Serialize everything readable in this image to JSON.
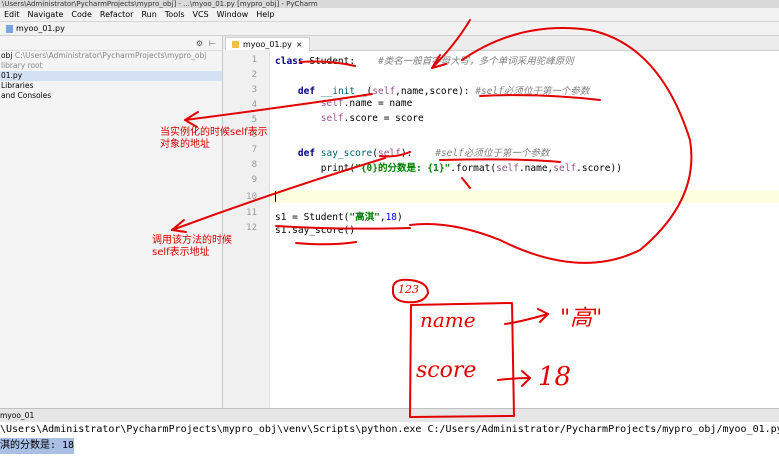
{
  "window": {
    "title": "\\Users\\Administrator\\PycharmProjects\\mypro_obj] - ...\\myoo_01.py [mypro_obj] - PyCharm"
  },
  "menu": [
    "Edit",
    "Navigate",
    "Code",
    "Refactor",
    "Run",
    "Tools",
    "VCS",
    "Window",
    "Help"
  ],
  "navbar": {
    "file": "myoo_01.py"
  },
  "project": {
    "rows": [
      {
        "text": "obj",
        "muted": "C:\\Users\\Administrator\\PycharmProjects\\mypro_obj"
      },
      {
        "text": "",
        "muted": "library root"
      },
      {
        "text": "01.py",
        "muted": ""
      },
      {
        "text": "Libraries",
        "muted": ""
      },
      {
        "text": "and Consoles",
        "muted": ""
      }
    ]
  },
  "editor": {
    "tab": "myoo_01.py",
    "line_numbers": [
      "1",
      "2",
      "3",
      "4",
      "5",
      "6",
      "7",
      "8",
      "9",
      "10",
      "11",
      "12"
    ],
    "lines": {
      "l1_kw": "class ",
      "l1_name": "Student:",
      "l1_cm": "#类名一般首字母大写，多个单词采用驼峰原则",
      "l3_kw": "def ",
      "l3_fn": "__init__",
      "l3_open": "(",
      "l3_self": "self",
      "l3_args": ",name,score):",
      "l3_cm": "#self必须位于第一个参数",
      "l4_self": "self",
      "l4_rest": ".name = name",
      "l5_self": "self",
      "l5_rest": ".score = score",
      "l7_kw": "def ",
      "l7_fn": "say_score",
      "l7_open": "(",
      "l7_self": "self",
      "l7_close": "):",
      "l7_cm": "#self必须位于第一个参数",
      "l8_print": "print(",
      "l8_str": "\"{0}的分数是: {1}\"",
      "l8_fmt": ".format(",
      "l8_self1": "self",
      "l8_mid": ".name,",
      "l8_self2": "self",
      "l8_end": ".score))",
      "l11_a": "s1 = ",
      "l11_cls": "Student(",
      "l11_str": "\"高淇\"",
      "l11_comma": ",",
      "l11_num": "18",
      "l11_close": ")",
      "l12": "s1.say_score()"
    }
  },
  "run": {
    "tab": "myoo_01",
    "cmd": "\\Users\\Administrator\\PycharmProjects\\mypro_obj\\venv\\Scripts\\python.exe C:/Users/Administrator/PycharmProjects/mypro_obj/myoo_01.py",
    "output": "淇的分数是: 18"
  },
  "annotations": {
    "note1_line1": "当实例化的时候self表示",
    "note1_line2": "对象的地址",
    "note2_line1": "调用该方法的时候",
    "note2_line2": "self表示地址",
    "addr": "123",
    "field1": "name",
    "val1": "\"高\"",
    "field2": "score",
    "val2": "18"
  },
  "colors": {
    "annotation": "#e30000",
    "keyword": "#000080",
    "comment": "#808080",
    "string": "#008000"
  }
}
